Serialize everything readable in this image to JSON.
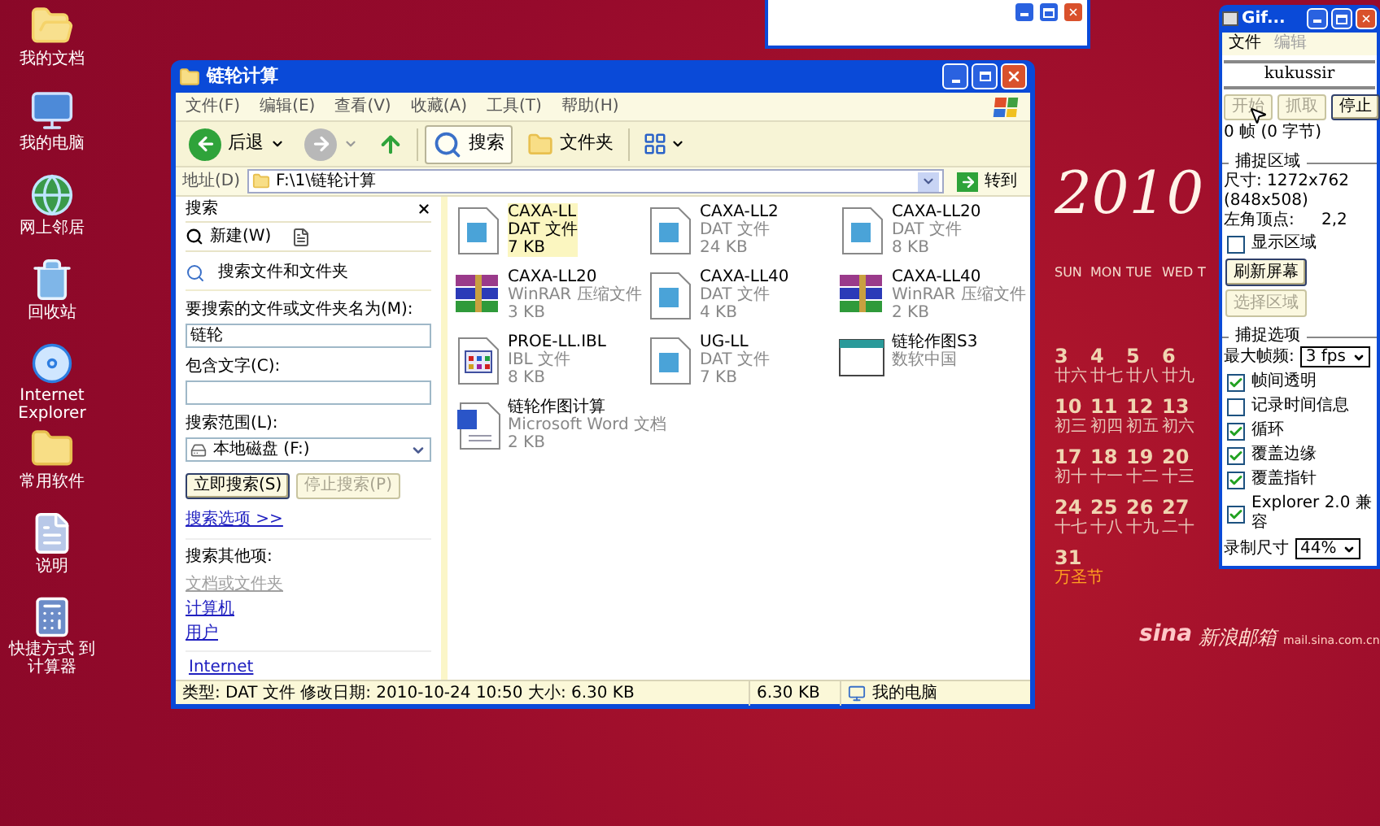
{
  "desktop_icons": [
    {
      "label": "我的文档",
      "kind": "documents"
    },
    {
      "label": "我的电脑",
      "kind": "computer"
    },
    {
      "label": "网上邻居",
      "kind": "network"
    },
    {
      "label": "回收站",
      "kind": "recycle"
    },
    {
      "label": "Internet Explorer",
      "kind": "ie"
    },
    {
      "label": "常用软件",
      "kind": "folder"
    },
    {
      "label": "说明",
      "kind": "notepad"
    },
    {
      "label": "快捷方式 到计算器",
      "kind": "calculator"
    }
  ],
  "calendar": {
    "year": "2010",
    "weekdays": [
      "SUN",
      "MON",
      "TUE",
      "WED",
      "T"
    ],
    "weeks": [
      [
        {
          "day": "3",
          "note": "廿六",
          "holiday": false
        },
        {
          "day": "4",
          "note": "廿七",
          "holiday": false
        },
        {
          "day": "5",
          "note": "廿八",
          "holiday": false
        },
        {
          "day": "6",
          "note": "廿九",
          "holiday": false
        }
      ],
      [
        {
          "day": "10",
          "note": "初三",
          "holiday": false
        },
        {
          "day": "11",
          "note": "初四",
          "holiday": false
        },
        {
          "day": "12",
          "note": "初五",
          "holiday": false
        },
        {
          "day": "13",
          "note": "初六",
          "holiday": false
        }
      ],
      [
        {
          "day": "17",
          "note": "初十",
          "holiday": false
        },
        {
          "day": "18",
          "note": "十一",
          "holiday": false
        },
        {
          "day": "19",
          "note": "十二",
          "holiday": false
        },
        {
          "day": "20",
          "note": "十三",
          "holiday": false
        }
      ],
      [
        {
          "day": "24",
          "note": "十七",
          "holiday": false
        },
        {
          "day": "25",
          "note": "十八",
          "holiday": false
        },
        {
          "day": "26",
          "note": "十九",
          "holiday": false
        },
        {
          "day": "27",
          "note": "二十",
          "holiday": false
        }
      ],
      [
        {
          "day": "31",
          "note": "万圣节",
          "holiday": true
        }
      ]
    ]
  },
  "branding": {
    "logo": "sina",
    "name": "新浪邮箱",
    "url": "mail.sina.com.cn"
  },
  "explorer": {
    "title": "链轮计算",
    "menu": [
      "文件(F)",
      "编辑(E)",
      "查看(V)",
      "收藏(A)",
      "工具(T)",
      "帮助(H)"
    ],
    "toolbar": {
      "back": "后退",
      "search": {
        "label": "搜索",
        "selected": true
      },
      "folders": {
        "label": "文件夹",
        "selected": false
      }
    },
    "address": {
      "label": "地址(D)",
      "value": "F:\\1\\链轮计算",
      "go": "转到"
    },
    "search_pane": {
      "title": "搜索",
      "new": "新建(W)",
      "heading": "搜索文件和文件夹",
      "fields": [
        {
          "label": "要搜索的文件或文件夹名为(M):",
          "value": "链轮"
        },
        {
          "label": "包含文字(C):"
        }
      ],
      "scope": {
        "label": "搜索范围(L):",
        "value": "本地磁盘 (F:)"
      },
      "buttons": [
        {
          "label": "立即搜索(S)",
          "disabled": false
        },
        {
          "label": "停止搜索(P)",
          "disabled": true
        }
      ],
      "options_link": "搜索选项 >>",
      "other_heading": "搜索其他项:",
      "other_links": [
        {
          "label": "文档或文件夹",
          "disabled": true
        },
        {
          "label": "计算机",
          "disabled": false
        },
        {
          "label": "用户",
          "disabled": false
        }
      ],
      "web_link": "Internet"
    },
    "files": [
      {
        "name": "CAXA-LL",
        "type": "DAT 文件",
        "size": "7 KB",
        "kind": "dat",
        "selected": true
      },
      {
        "name": "CAXA-LL2",
        "type": "DAT 文件",
        "size": "24 KB",
        "kind": "dat",
        "selected": false
      },
      {
        "name": "CAXA-LL20",
        "type": "DAT 文件",
        "size": "8 KB",
        "kind": "dat",
        "selected": false
      },
      {
        "name": "CAXA-LL20",
        "type": "WinRAR 压缩文件",
        "size": "3 KB",
        "kind": "rar",
        "selected": false
      },
      {
        "name": "CAXA-LL40",
        "type": "DAT 文件",
        "size": "4 KB",
        "kind": "dat",
        "selected": false
      },
      {
        "name": "CAXA-LL40",
        "type": "WinRAR 压缩文件",
        "size": "2 KB",
        "kind": "rar",
        "selected": false
      },
      {
        "name": "PROE-LL.IBL",
        "type": "IBL 文件",
        "size": "8 KB",
        "kind": "ibl",
        "selected": false
      },
      {
        "name": "UG-LL",
        "type": "DAT 文件",
        "size": "7 KB",
        "kind": "dat",
        "selected": false
      },
      {
        "name": "链轮作图S3",
        "type": "数软中国",
        "kind": "shortcut",
        "selected": false
      },
      {
        "name": "链轮作图计算",
        "type": "Microsoft Word 文档",
        "size": "2 KB",
        "kind": "doc",
        "selected": false
      }
    ],
    "status": {
      "info": "类型: DAT 文件 修改日期: 2010-10-24 10:50 大小: 6.30 KB",
      "size": "6.30 KB",
      "zone": "我的电脑"
    }
  },
  "gif_tool": {
    "title": "Gif...",
    "menu": [
      {
        "label": "文件",
        "disabled": false
      },
      {
        "label": "编辑",
        "disabled": true
      }
    ],
    "user": "kukussir",
    "buttons": [
      {
        "label": "开始",
        "disabled": true
      },
      {
        "label": "抓取",
        "disabled": true
      },
      {
        "label": "停止",
        "disabled": false
      }
    ],
    "counter": "0 帧 (0 字节)",
    "region": {
      "title": "捕捉区域",
      "size": "尺寸: 1272x762 (848x508)",
      "corner_label": "左角顶点:",
      "corner_value": "2,2",
      "show": {
        "label": "显示区域",
        "checked": false
      },
      "select": {
        "label": "选择区域",
        "disabled": true
      },
      "refresh": "刷新屏幕"
    },
    "options": {
      "title": "捕捉选项",
      "rate_label": "最大帧频:",
      "rate": "3 fps",
      "checks": [
        {
          "label": "帧间透明",
          "checked": true
        },
        {
          "label": "记录时间信息",
          "checked": false
        },
        {
          "label": "循环",
          "checked": true
        },
        {
          "label": "覆盖边缘",
          "checked": true
        },
        {
          "label": "覆盖指针",
          "checked": true
        },
        {
          "label": "Explorer 2.0 兼容",
          "checked": true
        }
      ],
      "size_label": "录制尺寸",
      "size": "44%"
    }
  }
}
